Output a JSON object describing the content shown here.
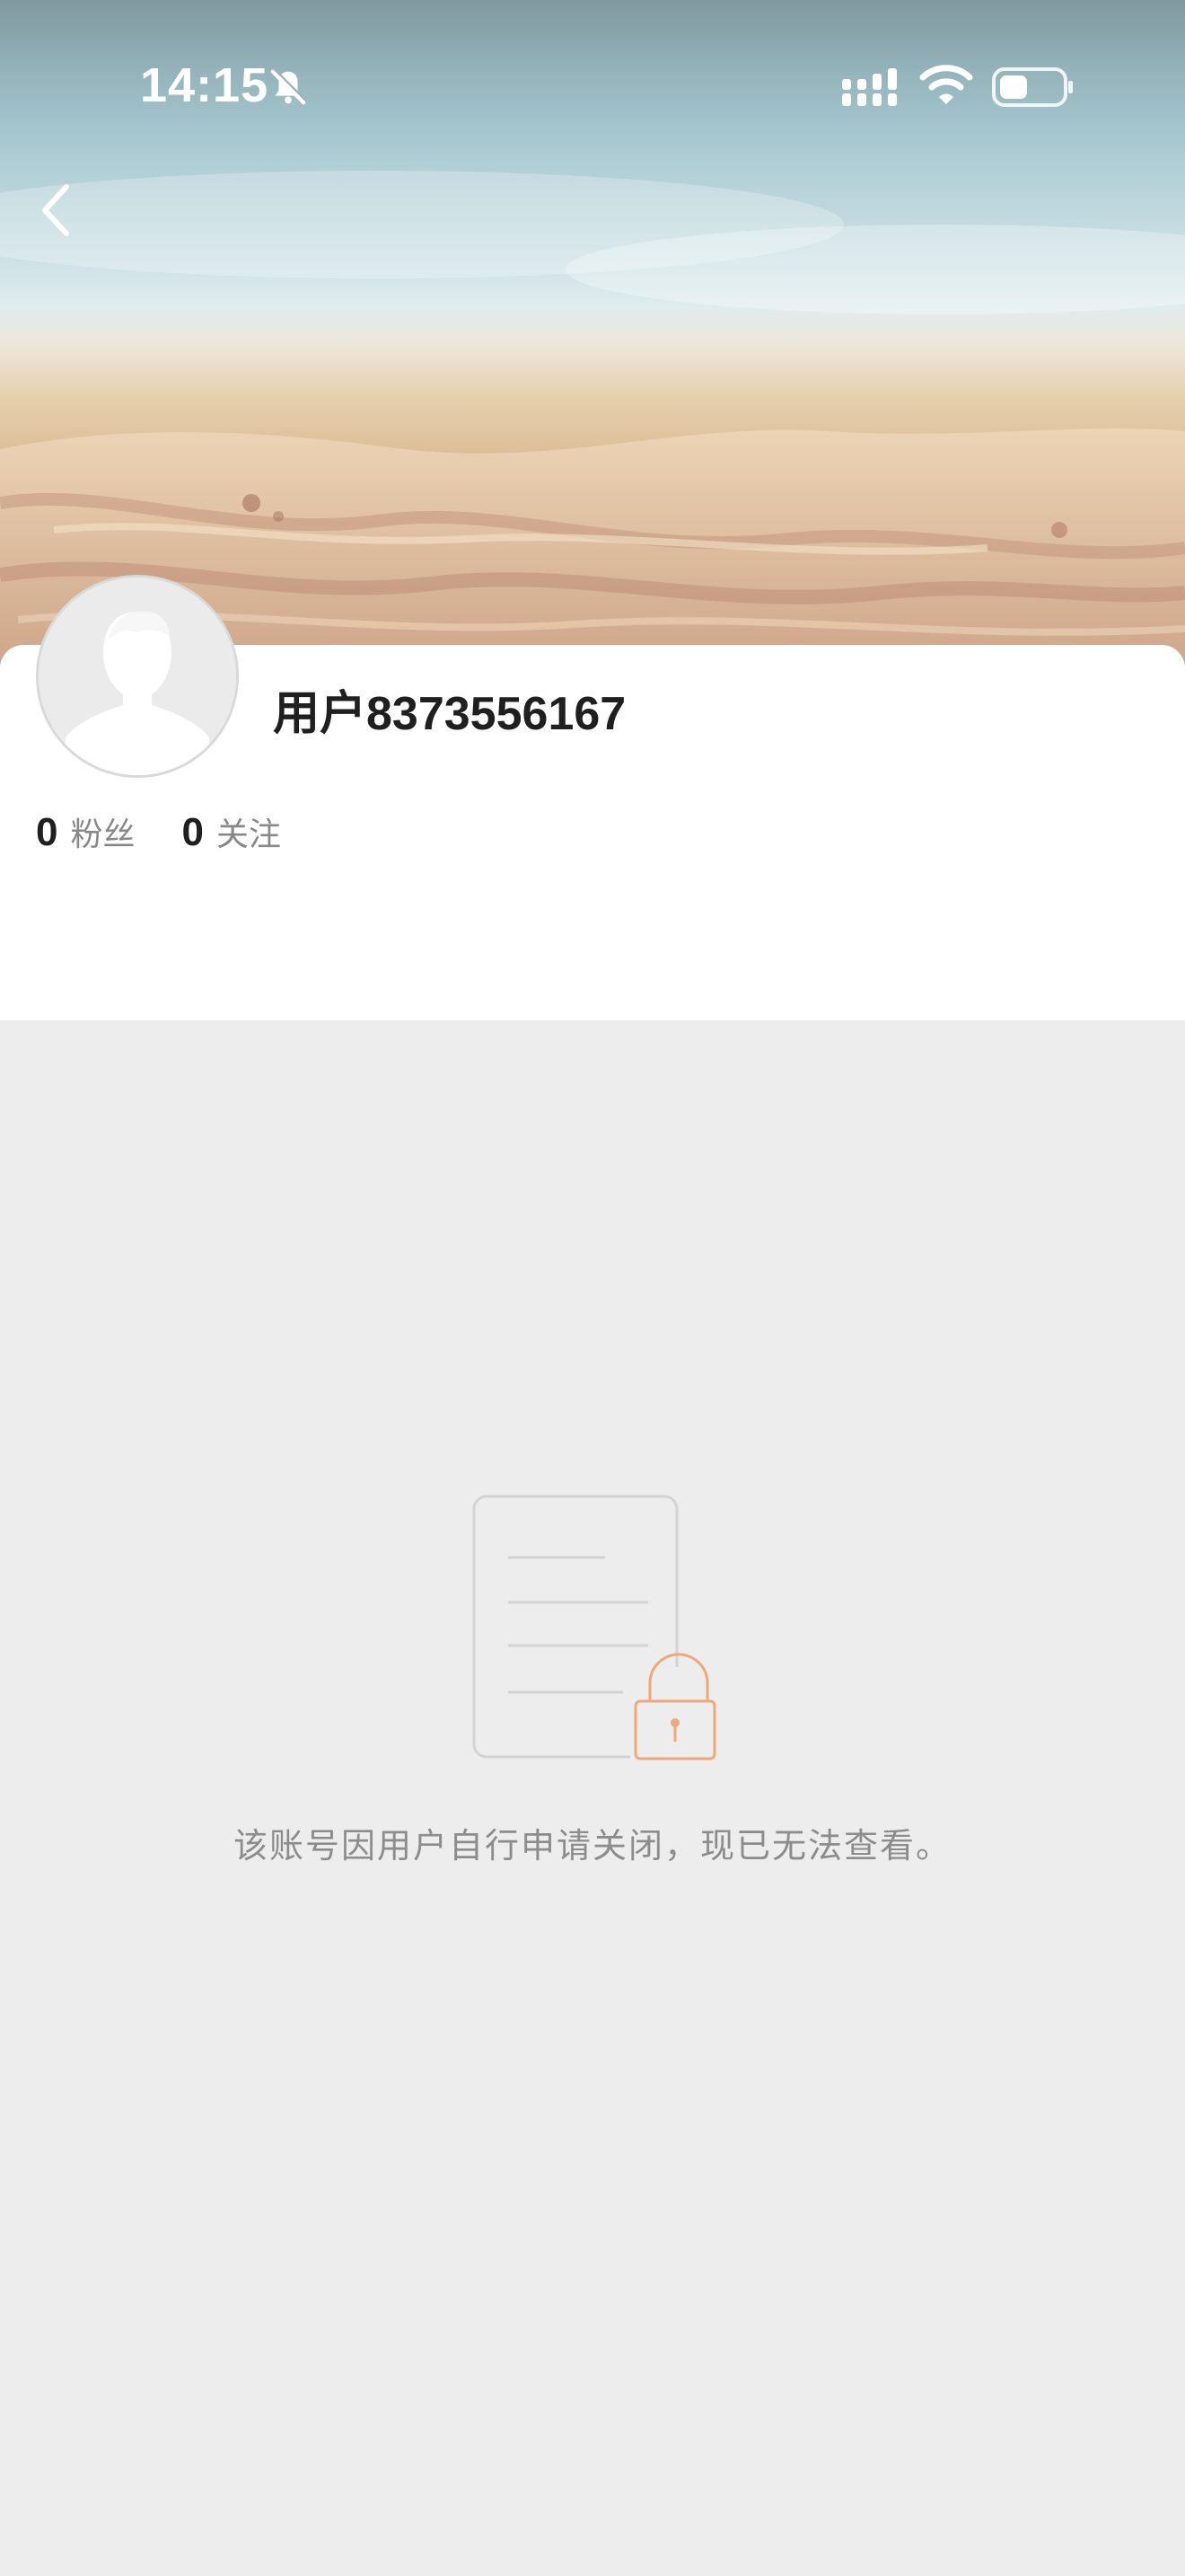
{
  "status_bar": {
    "time": "14:15",
    "icons": [
      "bell-muted-icon",
      "cellular-signal-icon",
      "wifi-icon",
      "battery-icon"
    ]
  },
  "navigation": {
    "back_icon": "chevron-left-icon"
  },
  "profile": {
    "username": "用户8373556167",
    "avatar": "default-avatar-icon",
    "stats": [
      {
        "count": "0",
        "label": "粉丝"
      },
      {
        "count": "0",
        "label": "关注"
      }
    ]
  },
  "closed_state": {
    "illustration": "locked-document-icon",
    "message": "该账号因用户自行申请关闭，现已无法查看。"
  },
  "colors": {
    "accent_lock": "#f0a878",
    "page_background": "#ededed",
    "card_background": "#ffffff",
    "muted_text": "#8c8c8c"
  }
}
